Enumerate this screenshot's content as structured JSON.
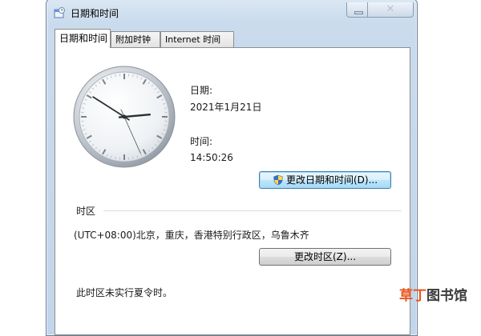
{
  "window": {
    "title": "日期和时间"
  },
  "tabs": [
    {
      "label": "日期和时间"
    },
    {
      "label": "附加时钟"
    },
    {
      "label": "Internet 时间"
    }
  ],
  "datetime": {
    "date_label": "日期:",
    "date_value": "2021年1月21日",
    "time_label": "时间:",
    "time_value": "14:50:26",
    "change_button": "更改日期和时间(D)..."
  },
  "clock": {
    "hours": 14,
    "minutes": 50,
    "seconds": 26
  },
  "timezone": {
    "section_label": "时区",
    "zone_value": "(UTC+08:00)北京，重庆，香港特别行政区，乌鲁木齐",
    "change_button": "更改时区(Z)...",
    "dst_note": "此时区未实行夏令时。"
  },
  "watermark": {
    "part1": "草丁",
    "part2": "图书馆"
  },
  "colors": {
    "window_frame": "#c2d5ea",
    "focus_border": "#3c7fb1",
    "watermark_accent": "#e8541e"
  },
  "icons": {
    "app": "datetime-app-icon",
    "close": "close-icon",
    "minimize": "minimize-icon",
    "uac": "uac-shield-icon"
  }
}
